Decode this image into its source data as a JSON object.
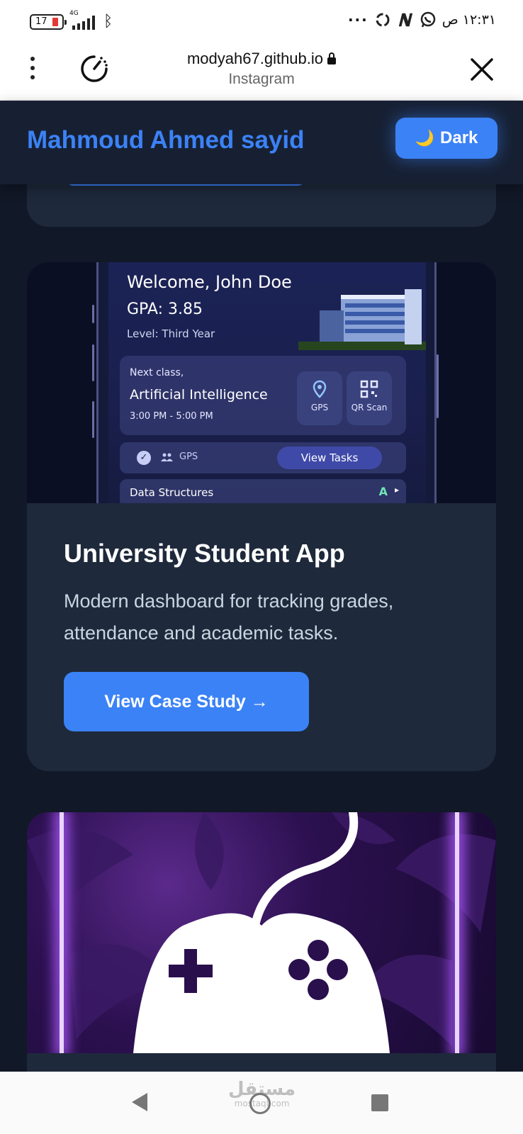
{
  "status_bar": {
    "battery": "17",
    "network": "4G",
    "time": "١٢:٣١ ص",
    "overflow": "···"
  },
  "browser": {
    "url": "modyah67.github.io",
    "source": "Instagram"
  },
  "site": {
    "brand": "Mahmoud Ahmed sayid",
    "theme_toggle": {
      "icon": "🌙",
      "label": "Dark"
    }
  },
  "project": {
    "title": "University Student App",
    "description": "Modern dashboard for tracking grades, attendance and academic tasks.",
    "cta": "View Case Study →",
    "screenshot": {
      "welcome": "Welcome, John Doe",
      "gpa": "GPA: 3.85",
      "level": "Level: Third Year",
      "next_class_label": "Next class,",
      "next_class": "Artificial Intelligence",
      "time": "3:00 PM - 5:00 PM",
      "gps_tile": "GPS",
      "qr_tile": "QR Scan",
      "gps_status": "GPS",
      "view_tasks": "View Tasks",
      "next_course": "Data Structures",
      "next_course_grade": "A"
    }
  },
  "watermark": {
    "ar": "مستقل",
    "en": "mostaql.com"
  },
  "colors": {
    "accent": "#3b82f6",
    "bg": "#111827",
    "card": "#1e293b",
    "header": "#172033"
  }
}
